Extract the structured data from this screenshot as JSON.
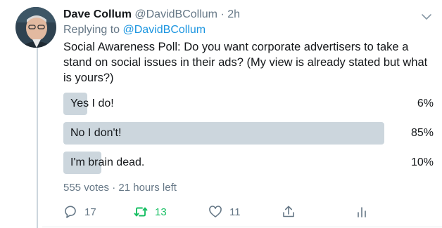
{
  "tweet": {
    "author_name": "Dave Collum",
    "author_handle": "@DavidBCollum",
    "separator": "·",
    "time": "2h",
    "replying_prefix": "Replying to",
    "replying_to": "@DavidBCollum",
    "text": "Social Awareness Poll: Do you want corporate advertisers to take a stand on social issues in their ads? (My view is already stated but what is yours?)"
  },
  "poll": {
    "options": [
      {
        "label": "Yes I do!",
        "percent_text": "6%",
        "percent": 6
      },
      {
        "label": "No I don't!",
        "percent_text": "85%",
        "percent": 85
      },
      {
        "label": "I'm brain dead.",
        "percent_text": "10%",
        "percent": 10
      }
    ],
    "meta": "555 votes · 21 hours left"
  },
  "actions": {
    "reply_count": "17",
    "retweet_count": "13",
    "like_count": "11"
  },
  "colors": {
    "text": "#14171a",
    "muted": "#657786",
    "link": "#1b95e0",
    "poll_bar": "#ccd6dd",
    "retweet_active": "#17bf63"
  },
  "icons": [
    "caret-down-icon",
    "reply-icon",
    "retweet-icon",
    "like-icon",
    "share-icon",
    "analytics-icon"
  ]
}
